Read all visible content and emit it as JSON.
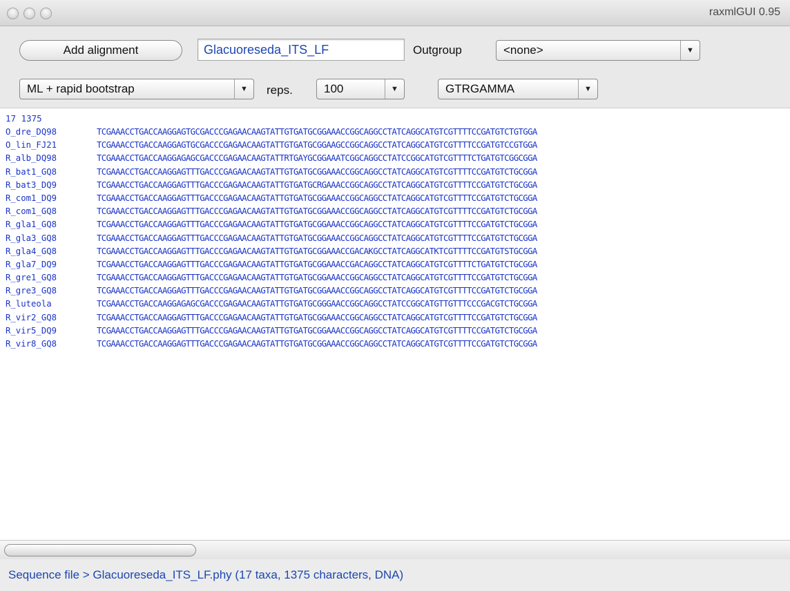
{
  "window": {
    "title": "raxmlGUI  0.95"
  },
  "toolbar": {
    "add_alignment_label": "Add alignment",
    "alignment_name": "Glacuoreseda_ITS_LF",
    "outgroup_label": "Outgroup",
    "outgroup_value": "<none>",
    "analysis_value": "ML + rapid bootstrap",
    "reps_label": "reps.",
    "reps_value": "100",
    "model_value": "GTRGAMMA"
  },
  "alignment": {
    "header": "17 1375",
    "rows": [
      {
        "name": "O_dre_DQ98",
        "seq": "TCGAAACCTGACCAAGGAGTGCGACCCGAGAACAAGTATTGTGATGCGGAAACCGGCAGGCCTATCAGGCATGTCGTTTTCCGATGTCTGTGGA"
      },
      {
        "name": "O_lin_FJ21",
        "seq": "TCGAAACCTGACCAAGGAGTGCGACCCGAGAACAAGTATTGTGATGCGGAAGCCGGCAGGCCTATCAGGCATGTCGTTTTCCGATGTCCGTGGA"
      },
      {
        "name": "R_alb_DQ98",
        "seq": "TCGAAACCTGACCAAGGAGAGCGACCCGAGAACAAGTATTRTGAYGCGGAAATCGGCAGGCCTATCCGGCATGTCGTTTTCTGATGTCGGCGGA"
      },
      {
        "name": "R_bat1_GQ8",
        "seq": "TCGAAACCTGACCAAGGAGTTTGACCCGAGAACAAGTATTGTGATGCGGAAACCGGCAGGCCTATCAGGCATGTCGTTTTCCGATGTCTGCGGA"
      },
      {
        "name": "R_bat3_DQ9",
        "seq": "TCGAAACCTGACCAAGGAGTTTGACCCGAGAACAAGTATTGTGATGCRGAAACCGGCAGGCCTATCAGGCATGTCGTTTTCCGATGTCTGCGGA"
      },
      {
        "name": "R_com1_DQ9",
        "seq": "TCGAAACCTGACCAAGGAGTTTGACCCGAGAACAAGTATTGTGATGCGGAAACCGGCAGGCCTATCAGGCATGTCGTTTTCCGATGTCTGCGGA"
      },
      {
        "name": "R_com1_GQ8",
        "seq": "TCGAAACCTGACCAAGGAGTTTGACCCGAGAACAAGTATTGTGATGCGGAAACCGGCAGGCCTATCAGGCATGTCGTTTTCCGATGTCTGCGGA"
      },
      {
        "name": "R_gla1_GQ8",
        "seq": "TCGAAACCTGACCAAGGAGTTTGACCCGAGAACAAGTATTGTGATGCGGAAACCGGCAGGCCTATCAGGCATGTCGTTTTCCGATGTCTGCGGA"
      },
      {
        "name": "R_gla3_GQ8",
        "seq": "TCGAAACCTGACCAAGGAGTTTGACCCGAGAACAAGTATTGTGATGCGGAAACCGGCAGGCCTATCAGGCATGTCGTTTTCCGATGTCTGCGGA"
      },
      {
        "name": "R_gla4_GQ8",
        "seq": "TCGAAACCTGACCAAGGAGTTTGACCCGAGAACAAGTATTGTGATGCGGAAACCGACAKGCCTATCAGGCATKTCGTTTTCCGATGTSTGCGGA"
      },
      {
        "name": "R_gla7_DQ9",
        "seq": "TCGAAACCTGACCAAGGAGTTTGACCCGAGAACAAGTATTGTGATGCGGAAACCGACAGGCCTATCAGGCATGTCGTTTTCTGATGTCTGCGGA"
      },
      {
        "name": "R_gre1_GQ8",
        "seq": "TCGAAACCTGACCAAGGAGTTTGACCCGAGAACAAGTATTGTGATGCGGAAACCGGCAGGCCTATCAGGCATGTCGTTTTCCGATGTCTGCGGA"
      },
      {
        "name": "R_gre3_GQ8",
        "seq": "TCGAAACCTGACCAAGGAGTTTGACCCGAGAACAAGTATTGTGATGCGGAAACCGGCAGGCCTATCAGGCATGTCGTTTTCCGATGTCTGCGGA"
      },
      {
        "name": "R_luteola",
        "seq": "TCGAAACCTGACCAAGGAGAGCGACCCGAGAACAAGTATTGTGATGCGGGAACCGGCAGGCCTATCCGGCATGTTGTTTCCCGACGTCTGCGGA"
      },
      {
        "name": "R_vir2_GQ8",
        "seq": "TCGAAACCTGACCAAGGAGTTTGACCCGAGAACAAGTATTGTGATGCGGAAACCGGCAGGCCTATCAGGCATGTCGTTTTCCGATGTCTGCGGA"
      },
      {
        "name": "R_vir5_DQ9",
        "seq": "TCGAAACCTGACCAAGGAGTTTGACCCGAGAACAAGTATTGTGATGCGGAAACCGGCAGGCCTATCAGGCATGTCGTTTTCCGATGTCTGCGGA"
      },
      {
        "name": "R_vir8_GQ8",
        "seq": "TCGAAACCTGACCAAGGAGTTTGACCCGAGAACAAGTATTGTGATGCGGAAACCGGCAGGCCTATCAGGCATGTCGTTTTCCGATGTCTGCGGA"
      }
    ]
  },
  "status": {
    "text": "Sequence file > Glacuoreseda_ITS_LF.phy  (17 taxa, 1375 characters, DNA)"
  },
  "colors": {
    "sequence_text": "#1a34c8",
    "status_text": "#1c47b0"
  }
}
